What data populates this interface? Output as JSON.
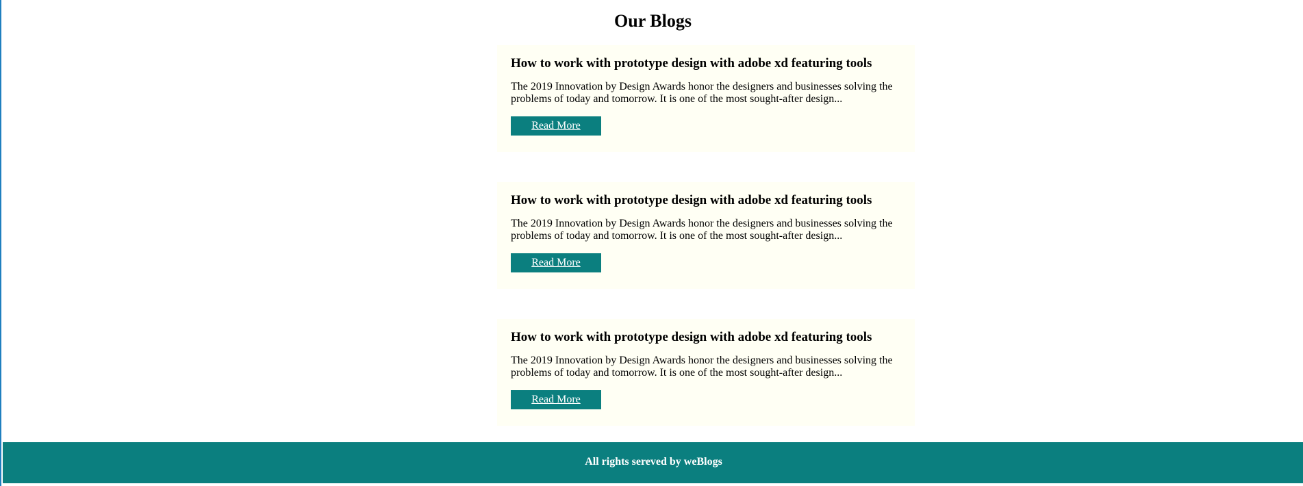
{
  "page": {
    "title": "Our Blogs"
  },
  "blogs": [
    {
      "title": "How to work with prototype design with adobe xd featuring tools",
      "excerpt": "The 2019 Innovation by Design Awards honor the designers and businesses solving the problems of today and tomorrow. It is one of the most sought-after design...",
      "button": "Read More"
    },
    {
      "title": "How to work with prototype design with adobe xd featuring tools",
      "excerpt": "The 2019 Innovation by Design Awards honor the designers and businesses solving the problems of today and tomorrow. It is one of the most sought-after design...",
      "button": "Read More"
    },
    {
      "title": "How to work with prototype design with adobe xd featuring tools",
      "excerpt": "The 2019 Innovation by Design Awards honor the designers and businesses solving the problems of today and tomorrow. It is one of the most sought-after design...",
      "button": "Read More"
    }
  ],
  "footer": {
    "text": "All rights sereved by weBlogs"
  },
  "colors": {
    "accent": "#0b7f7f",
    "card_background": "#fffff4",
    "left_border": "#1f7fbf"
  }
}
